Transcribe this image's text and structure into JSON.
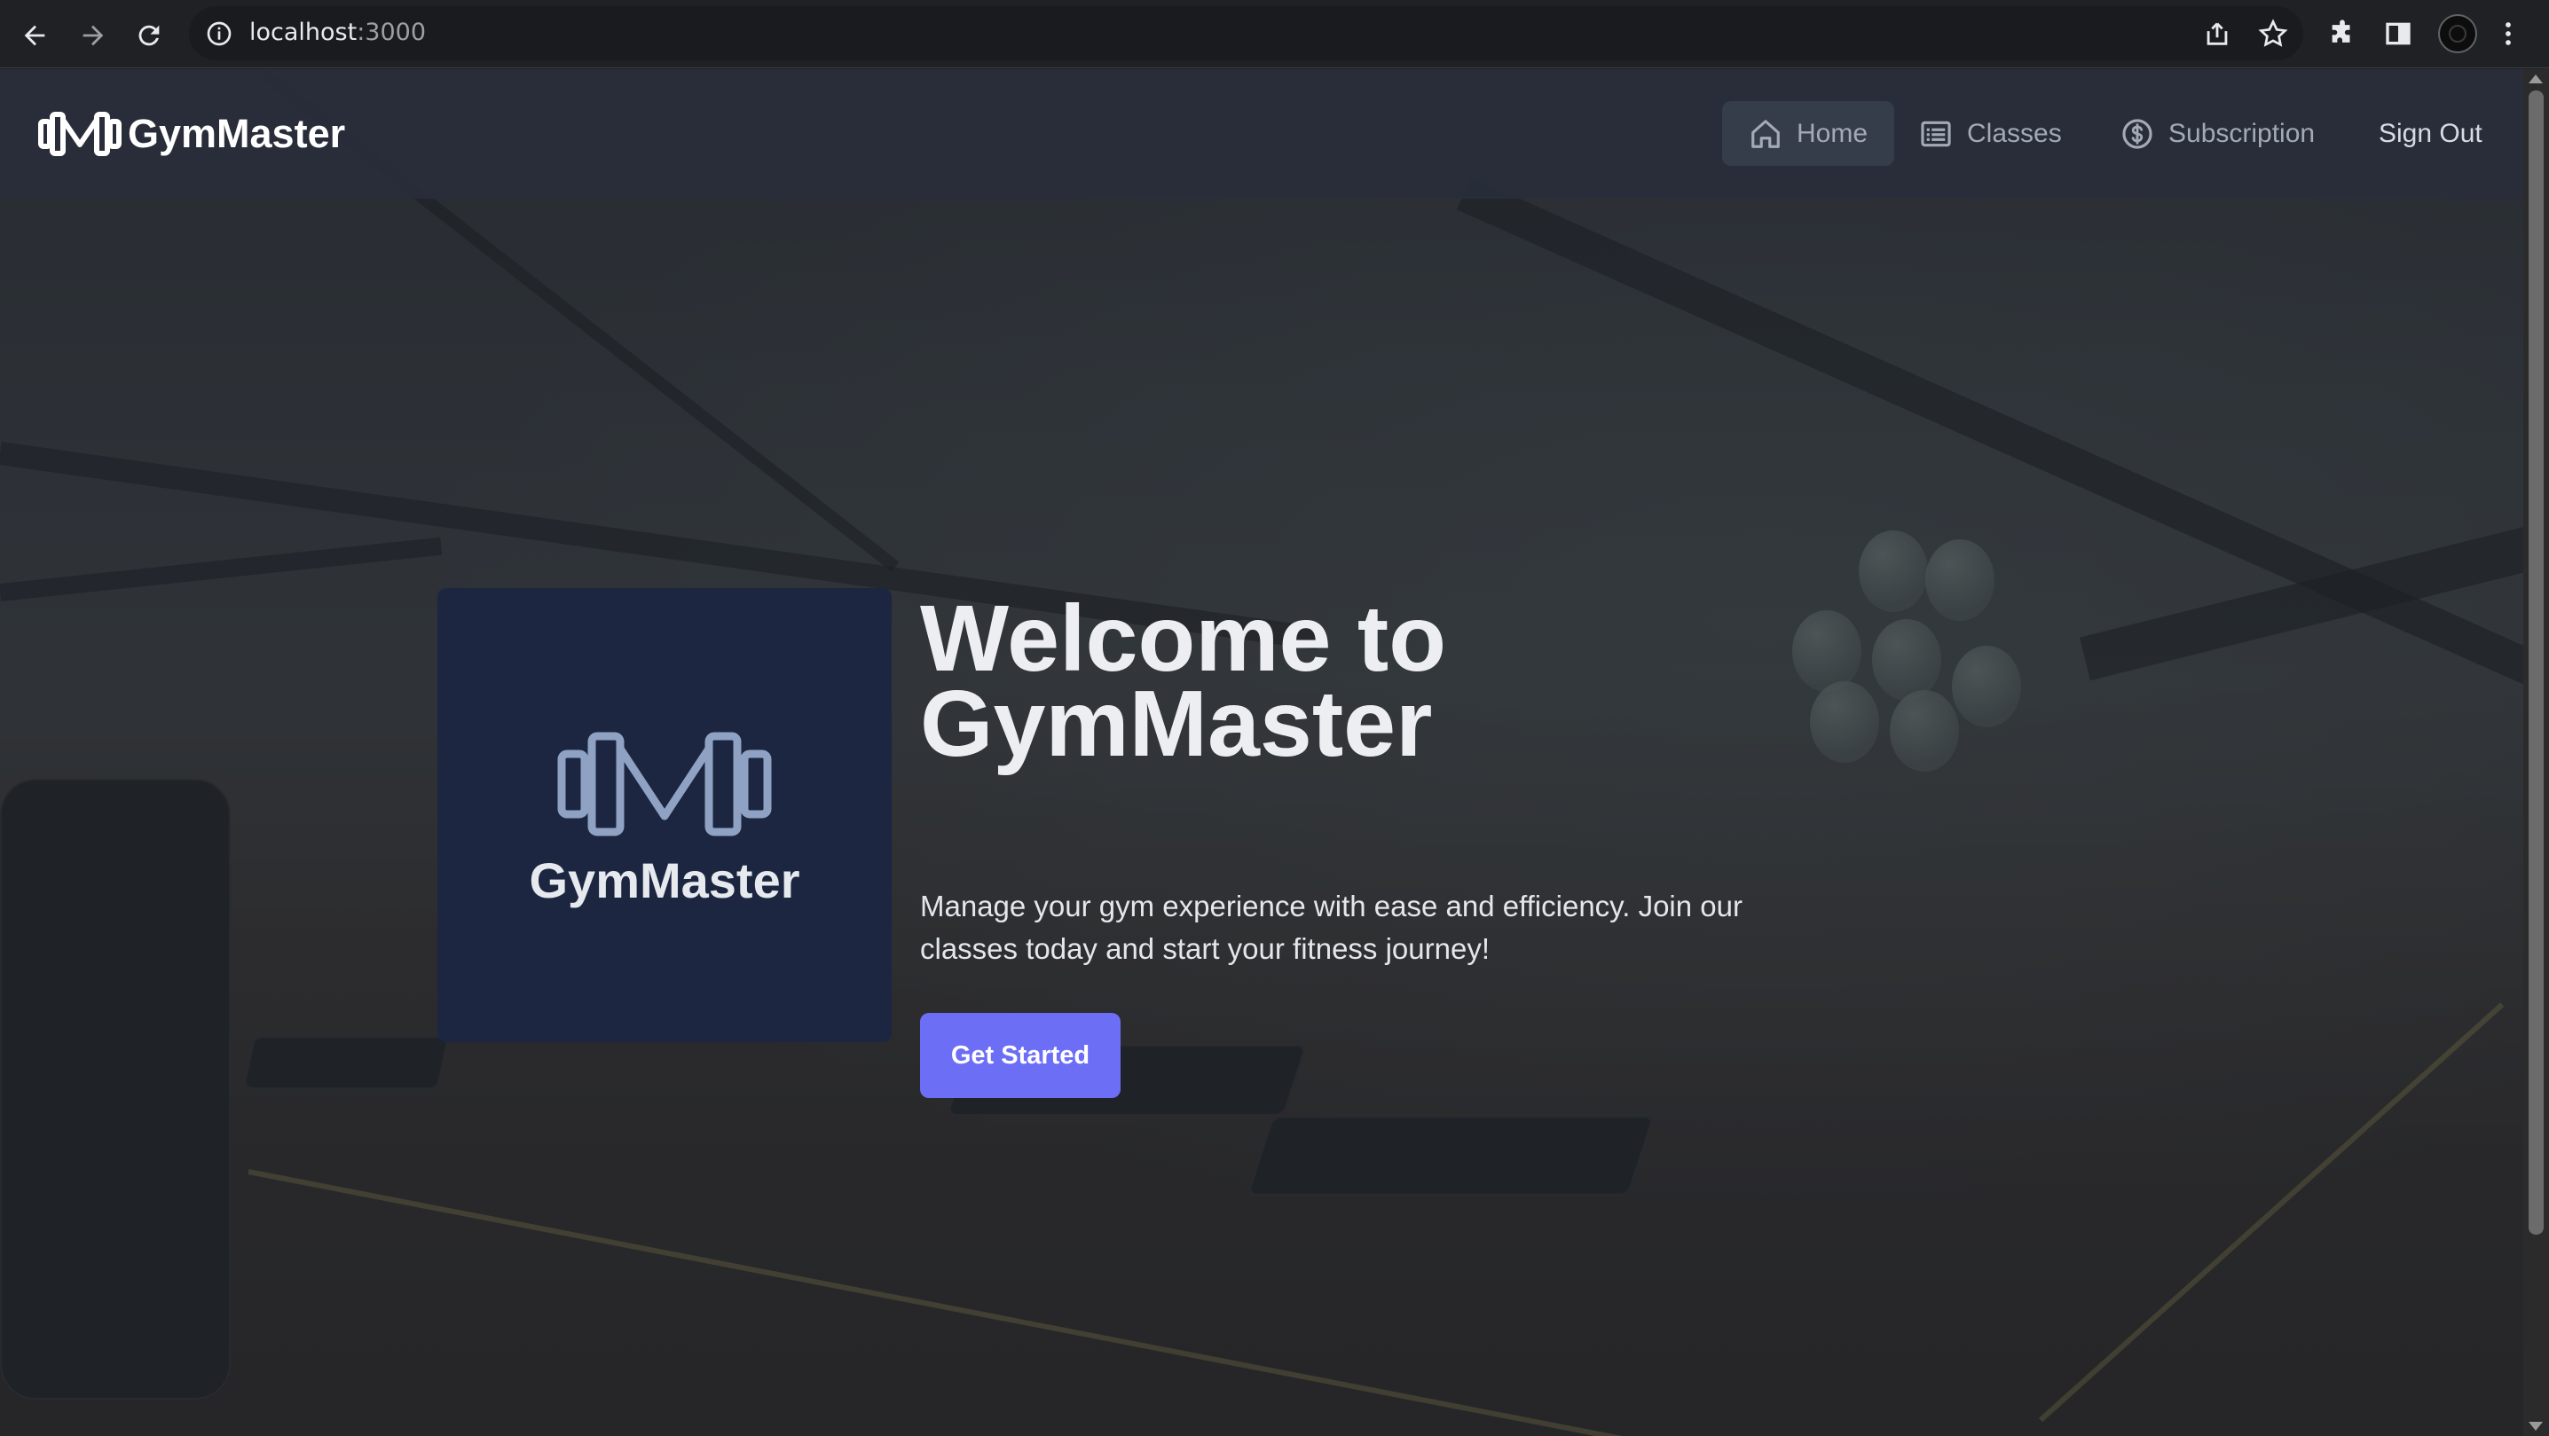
{
  "browser": {
    "url_host": "localhost",
    "url_port": ":3000",
    "back_icon": "arrow-left-icon",
    "forward_icon": "arrow-right-icon",
    "reload_icon": "reload-icon",
    "info_icon": "info-icon",
    "share_icon": "share-icon",
    "bookmark_icon": "star-icon",
    "extensions_icon": "puzzle-icon",
    "sidepanel_icon": "side-panel-icon",
    "menu_icon": "kebab-menu-icon"
  },
  "navbar": {
    "brand": "GymMaster",
    "items": [
      {
        "label": "Home",
        "icon": "home-icon",
        "active": true
      },
      {
        "label": "Classes",
        "icon": "list-icon",
        "active": false
      },
      {
        "label": "Subscription",
        "icon": "dollar-circle-icon",
        "active": false
      }
    ],
    "signout": "Sign Out"
  },
  "hero": {
    "logo_card_title": "GymMaster",
    "headline_line1": "Welcome to",
    "headline_line2": "GymMaster",
    "subtitle": "Manage your gym experience with ease and efficiency. Join our classes today and start your fitness journey!",
    "cta_label": "Get Started"
  },
  "colors": {
    "accent": "#6c6ff5",
    "navbar_bg": "#282e3a",
    "card_bg": "#1c2640",
    "logo_stroke": "#8fa2c3"
  }
}
